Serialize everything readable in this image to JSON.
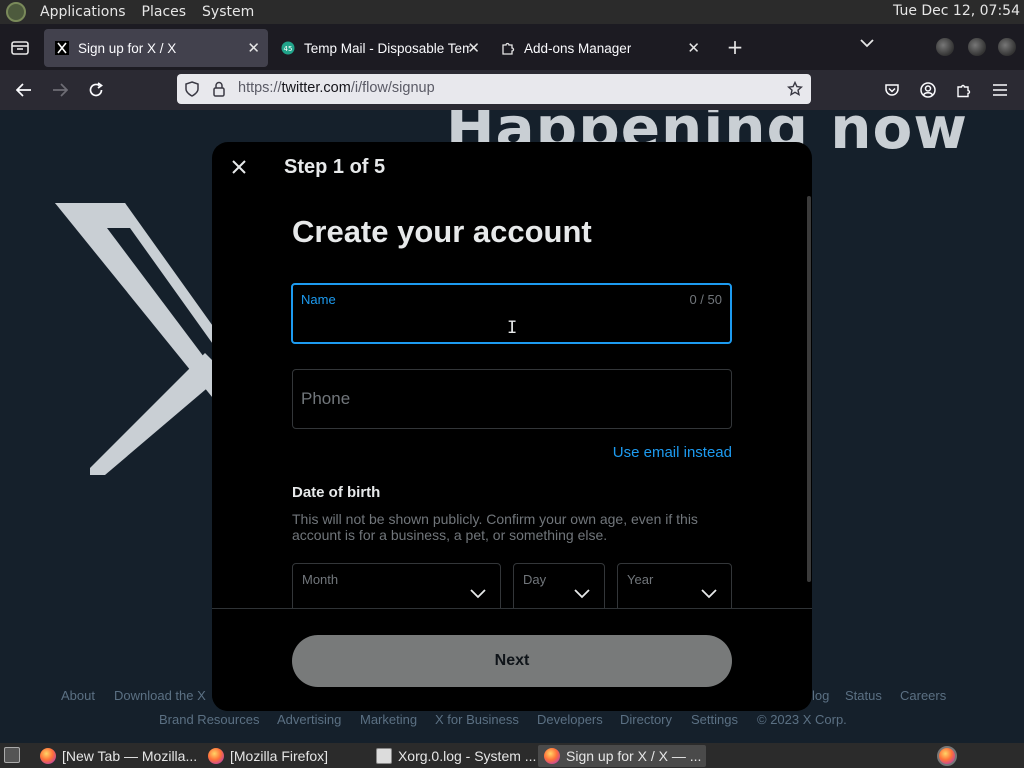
{
  "top_panel": {
    "menus": [
      "Applications",
      "Places",
      "System"
    ],
    "clock": "Tue Dec 12, 07:54"
  },
  "tabs": [
    {
      "title": "Sign up for X / X",
      "icon": "x-logo-icon",
      "active": true
    },
    {
      "title": "Temp Mail - Disposable Tem",
      "icon": "temp-mail-icon",
      "active": false
    },
    {
      "title": "Add-ons Manager",
      "icon": "puzzle-icon",
      "active": false
    }
  ],
  "urlbar": {
    "url_prefix": "https://",
    "url_host": "twitter.com",
    "url_path": "/i/flow/signup"
  },
  "page": {
    "headline": "Happening now",
    "footer_row1": [
      "About",
      "Download the X",
      "log",
      "Status",
      "Careers"
    ],
    "footer_row2": [
      "Brand Resources",
      "Advertising",
      "Marketing",
      "X for Business",
      "Developers",
      "Directory",
      "Settings",
      "© 2023 X Corp."
    ]
  },
  "modal": {
    "step": "Step 1 of 5",
    "title": "Create your account",
    "name_label": "Name",
    "name_counter": "0 / 50",
    "name_value": "",
    "phone_placeholder": "Phone",
    "use_email": "Use email instead",
    "dob_title": "Date of birth",
    "dob_desc": "This will not be shown publicly. Confirm your own age, even if this account is for a business, a pet, or something else.",
    "month_label": "Month",
    "day_label": "Day",
    "year_label": "Year",
    "next_label": "Next"
  },
  "taskbar": {
    "tasks": [
      {
        "label": "[New Tab — Mozilla...",
        "icon": "firefox-icon"
      },
      {
        "label": "[Mozilla Firefox]",
        "icon": "firefox-icon"
      },
      {
        "label": "Xorg.0.log - System ...",
        "icon": "log-viewer-icon"
      },
      {
        "label": "Sign up for X / X — ...",
        "icon": "firefox-icon"
      }
    ]
  },
  "colors": {
    "accent": "#1d9bf0",
    "modal_bg": "#000000",
    "page_bg": "#15202b",
    "next_button": "#787a7a"
  }
}
